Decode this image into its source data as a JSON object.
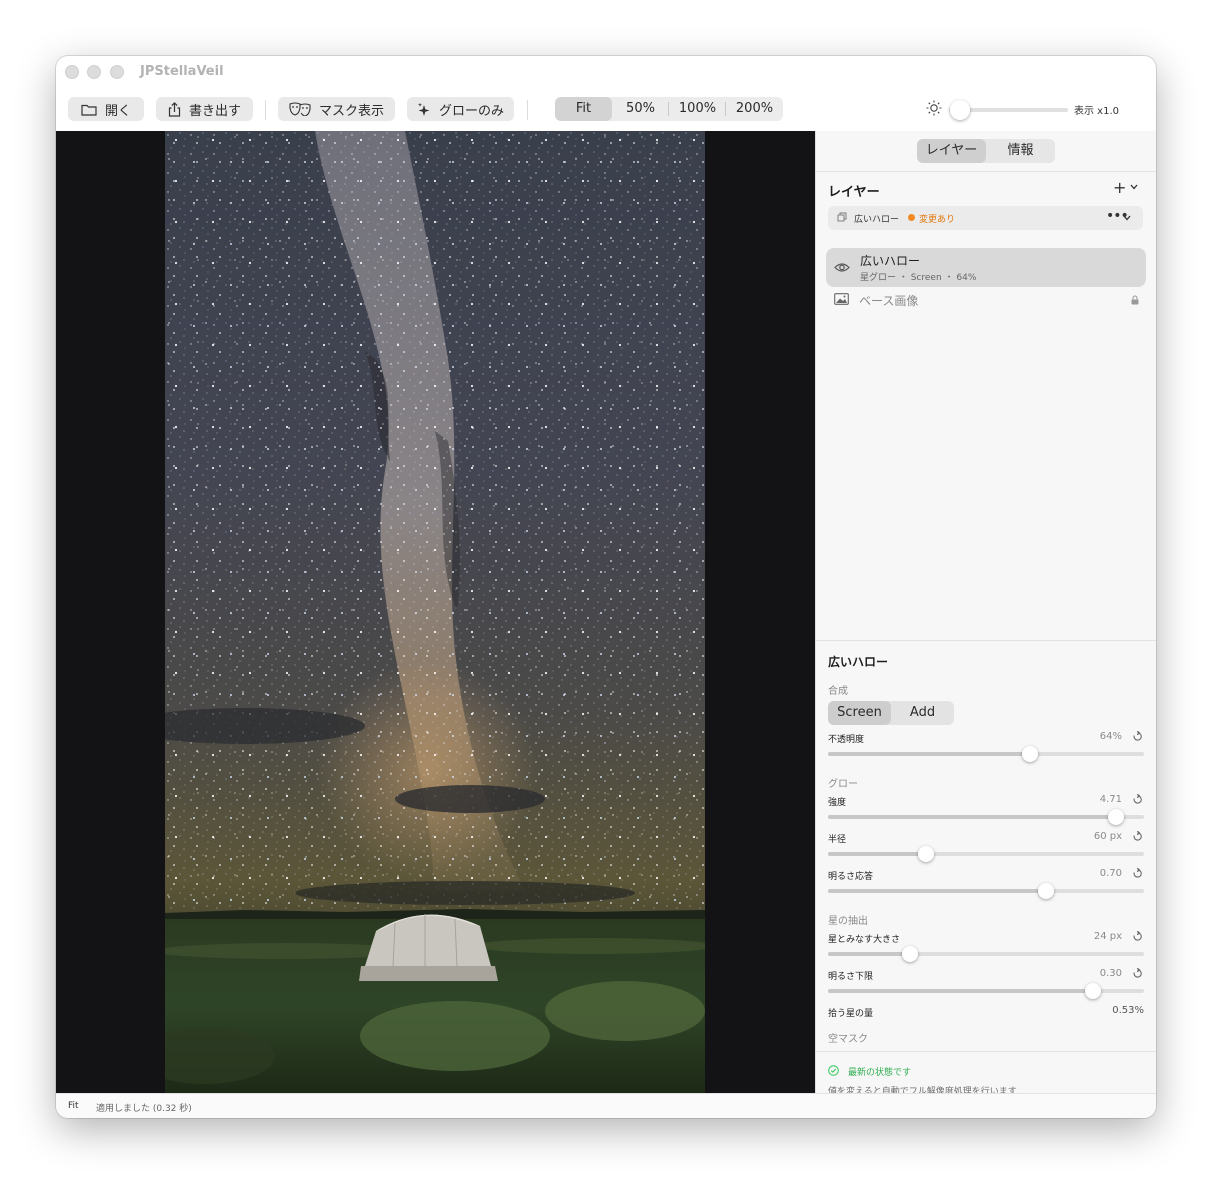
{
  "window": {
    "title": "JPStellaVeil"
  },
  "toolbar": {
    "open_label": "開く",
    "export_label": "書き出す",
    "mask_label": "マスク表示",
    "glow_only_label": "グローのみ",
    "zoom_options": [
      "Fit",
      "50%",
      "100%",
      "200%"
    ],
    "zoom_selected": "Fit",
    "display_zoom_label": "表示 x1.0",
    "brightness_level": 0.0
  },
  "panel": {
    "tabs": [
      "レイヤー",
      "情報"
    ],
    "tab_selected": "レイヤー",
    "layers_title": "レイヤー",
    "add_symbol": "+",
    "preset": {
      "name": "広いハロー",
      "changed_label": "変更あり",
      "menu_symbol": "•••"
    },
    "layers": [
      {
        "name": "広いハロー",
        "sub": "星グロー ・ Screen ・ 64%",
        "selected": true
      },
      {
        "name": "ベース画像",
        "locked": true
      }
    ],
    "props": {
      "title": "広いハロー",
      "blend_group": "合成",
      "blend_options": [
        "Screen",
        "Add"
      ],
      "blend_selected": "Screen",
      "opacity": {
        "label": "不透明度",
        "value": "64%",
        "level": 0.64
      },
      "glow_group": "グロー",
      "strength": {
        "label": "強度",
        "value": "4.71",
        "level": 0.91
      },
      "radius": {
        "label": "半径",
        "value": "60 px",
        "level": 0.31
      },
      "brightness_response": {
        "label": "明るさ応答",
        "value": "0.70",
        "level": 0.69
      },
      "star_group": "星の抽出",
      "star_size": {
        "label": "星とみなす大きさ",
        "value": "24 px",
        "level": 0.26
      },
      "brightness_floor": {
        "label": "明るさ下限",
        "value": "0.30",
        "level": 0.84
      },
      "picked_amount": {
        "label": "拾う星の量",
        "value": "0.53%"
      },
      "sky_mask_group": "空マスク"
    },
    "status": {
      "ok_label": "最新の状態です",
      "note": "値を変えると自動でフル解像度処理を行います"
    }
  },
  "statusbar": {
    "zoom": "Fit",
    "message": "適用しました (0.32 秒)"
  },
  "colors": {
    "accent_orange": "#f08a24",
    "ok_green": "#34c759",
    "canvas_bg": "#131315"
  }
}
